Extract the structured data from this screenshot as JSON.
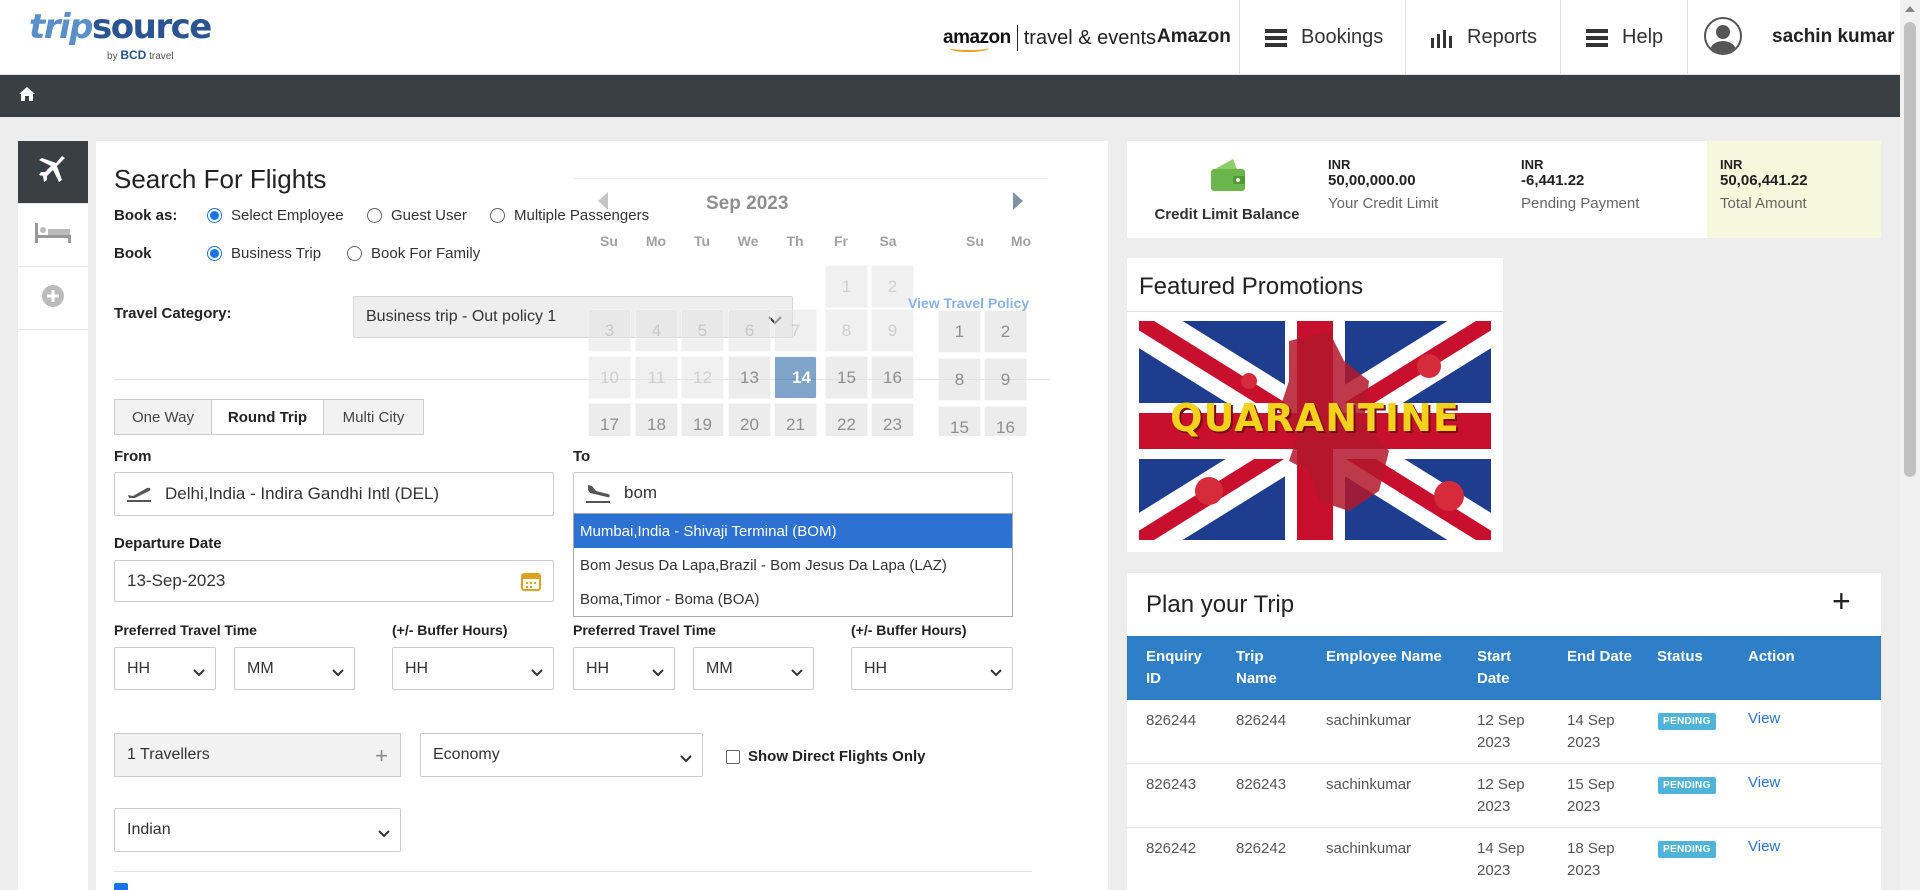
{
  "header": {
    "logo_main_1": "trip",
    "logo_main_2": "source",
    "logo_by": "by",
    "logo_bcd": "BCD",
    "logo_travel": "travel",
    "amazon_word": "amazon",
    "amazon_tagline": "travel & events",
    "company": "Amazon",
    "nav": [
      {
        "label": "Bookings",
        "icon": "hamburger-icon"
      },
      {
        "label": "Reports",
        "icon": "bar-chart-icon"
      },
      {
        "label": "Help",
        "icon": "hamburger-icon"
      }
    ],
    "user_name": "sachin kumar"
  },
  "search": {
    "title": "Search For Flights",
    "book_as_label": "Book as:",
    "book_as_options": [
      "Select Employee",
      "Guest User",
      "Multiple Passengers"
    ],
    "book_as_selected": "Select Employee",
    "book_label": "Book",
    "book_options": [
      "Business Trip",
      "Book For Family"
    ],
    "book_selected": "Business Trip",
    "travel_category_label": "Travel Category:",
    "travel_category_value": "Business trip - Out policy 1",
    "view_travel_policy": "View Travel Policy",
    "trip_types": [
      "One Way",
      "Round Trip",
      "Multi City"
    ],
    "trip_type_selected": "Round Trip",
    "from_label": "From",
    "from_value": "Delhi,India - Indira Gandhi Intl (DEL)",
    "to_label": "To",
    "to_value": "bom",
    "to_suggestions": [
      "Mumbai,India - Shivaji Terminal (BOM)",
      "Bom Jesus Da Lapa,Brazil - Bom Jesus Da Lapa (LAZ)",
      "Boma,Timor - Boma (BOA)"
    ],
    "departure_label": "Departure Date",
    "departure_value": "13-Sep-2023",
    "pref_time_label": "Preferred Travel Time",
    "buffer_label": "(+/- Buffer Hours)",
    "hh": "HH",
    "mm": "MM",
    "travellers": "1 Travellers",
    "cabin": "Economy",
    "direct_only": "Show Direct Flights Only",
    "nationality": "Indian"
  },
  "calendar": {
    "month": "Sep 2023",
    "dow": [
      "Su",
      "Mo",
      "Tu",
      "We",
      "Th",
      "Fr",
      "Sa"
    ],
    "second_dow": [
      "Su",
      "Mo"
    ],
    "selected_day": "14"
  },
  "credit": {
    "title": "Credit Limit Balance",
    "currency": "INR",
    "credit_limit": "50,00,000.00",
    "credit_limit_caption": "Your Credit Limit",
    "pending": "-6,441.22",
    "pending_caption": "Pending Payment",
    "total": "50,06,441.22",
    "total_caption": "Total Amount"
  },
  "promo": {
    "title": "Featured Promotions",
    "image_text": "QUARANTINE"
  },
  "plan": {
    "title": "Plan your Trip",
    "add": "+",
    "columns": [
      [
        "Enquiry",
        "ID"
      ],
      [
        "Trip",
        "Name"
      ],
      [
        "Employee Name",
        ""
      ],
      [
        "Start",
        "Date"
      ],
      [
        "End Date",
        ""
      ],
      [
        "Status",
        ""
      ],
      [
        "Action",
        ""
      ]
    ],
    "rows": [
      {
        "id": "826244",
        "name": "826244",
        "employee": "sachinkumar",
        "start1": "12 Sep",
        "start2": "2023",
        "end1": "14 Sep",
        "end2": "2023",
        "status": "PENDING",
        "action": "View"
      },
      {
        "id": "826243",
        "name": "826243",
        "employee": "sachinkumar",
        "start1": "12 Sep",
        "start2": "2023",
        "end1": "15 Sep",
        "end2": "2023",
        "status": "PENDING",
        "action": "View"
      },
      {
        "id": "826242",
        "name": "826242",
        "employee": "sachinkumar",
        "start1": "14 Sep",
        "start2": "2023",
        "end1": "18 Sep",
        "end2": "2023",
        "status": "PENDING",
        "action": "View"
      }
    ]
  },
  "colors": {
    "accent": "#2f7fc8",
    "dark_bar": "#3a3f44",
    "highlight": "#2d72d2",
    "badge": "#4fb4d8"
  }
}
